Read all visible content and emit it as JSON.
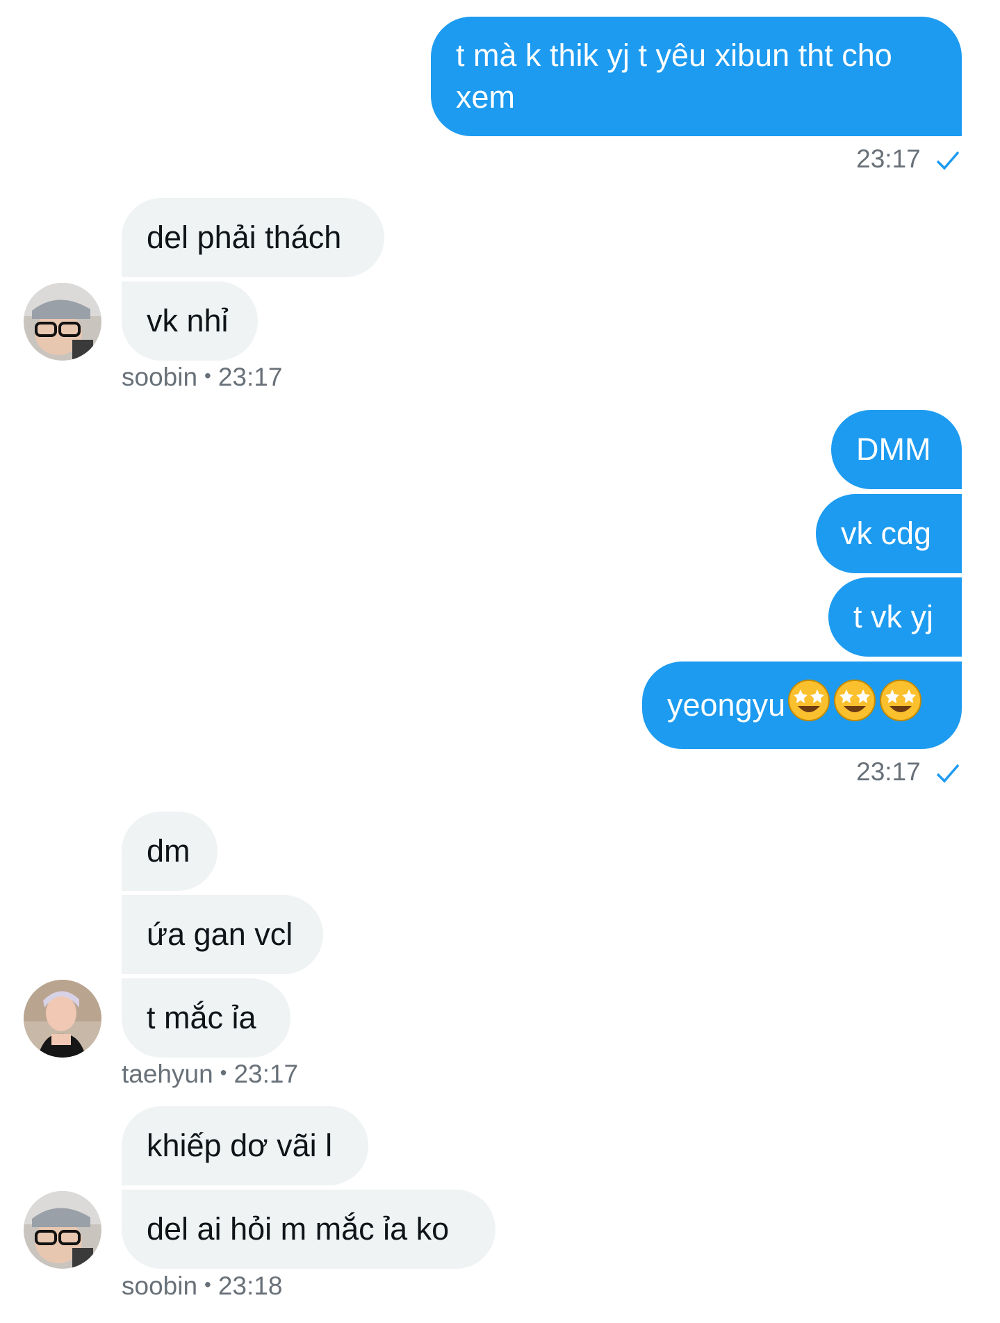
{
  "colors": {
    "outgoing": "#1d9bf0",
    "incoming": "#eff3f4",
    "meta": "#687078"
  },
  "groups": [
    {
      "sender": "me",
      "messages": [
        "t mà k thik yj t yêu xibun tht cho",
        "xem"
      ],
      "time": "23:17"
    },
    {
      "sender": "soobin",
      "messages": [
        "del phải thách",
        "vk nhỉ"
      ],
      "time": "23:17"
    },
    {
      "sender": "me",
      "messages": [
        "DMM",
        "vk cdg",
        "t vk yj",
        "yeongyu"
      ],
      "emoji": [
        "star-struck",
        "star-struck",
        "star-struck"
      ],
      "time": "23:17"
    },
    {
      "sender": "taehyun",
      "messages": [
        "dm",
        "ứa gan vcl",
        "t mắc ỉa"
      ],
      "time": "23:17"
    },
    {
      "sender": "soobin",
      "messages": [
        "khiếp dơ vãi l",
        "del ai hỏi m mắc ỉa ko"
      ],
      "time": "23:18"
    }
  ],
  "icons": {
    "read_receipt": "check-icon",
    "avatar_soobin": "avatar-soobin",
    "avatar_taehyun": "avatar-taehyun"
  }
}
